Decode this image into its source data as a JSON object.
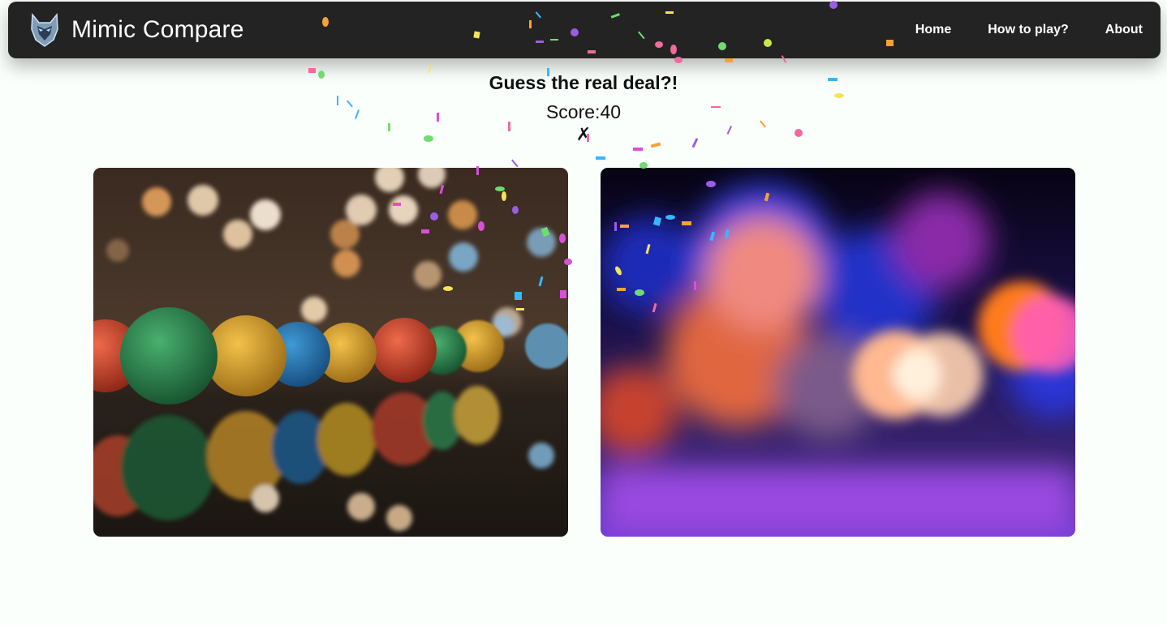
{
  "header": {
    "brand": "Mimic Compare",
    "logo_icon": "wolf-mask-icon",
    "nav": [
      "Home",
      "How to play?",
      "About"
    ]
  },
  "game": {
    "title": "Guess the real deal?!",
    "score_label": "Score:",
    "score": 40,
    "result_mark": "✗"
  },
  "images": {
    "left": {
      "subject": "colorful balls on reflective surface with bokeh lights"
    },
    "right": {
      "subject": "blurred colorful bokeh lights"
    }
  },
  "colors": {
    "navbar": "#232323",
    "background": "#fbfffb",
    "confetti": [
      "#f06aa0",
      "#9b5de5",
      "#f4a23a",
      "#6fdc6f",
      "#38b6ff",
      "#f7e35a",
      "#d94fd9"
    ]
  }
}
